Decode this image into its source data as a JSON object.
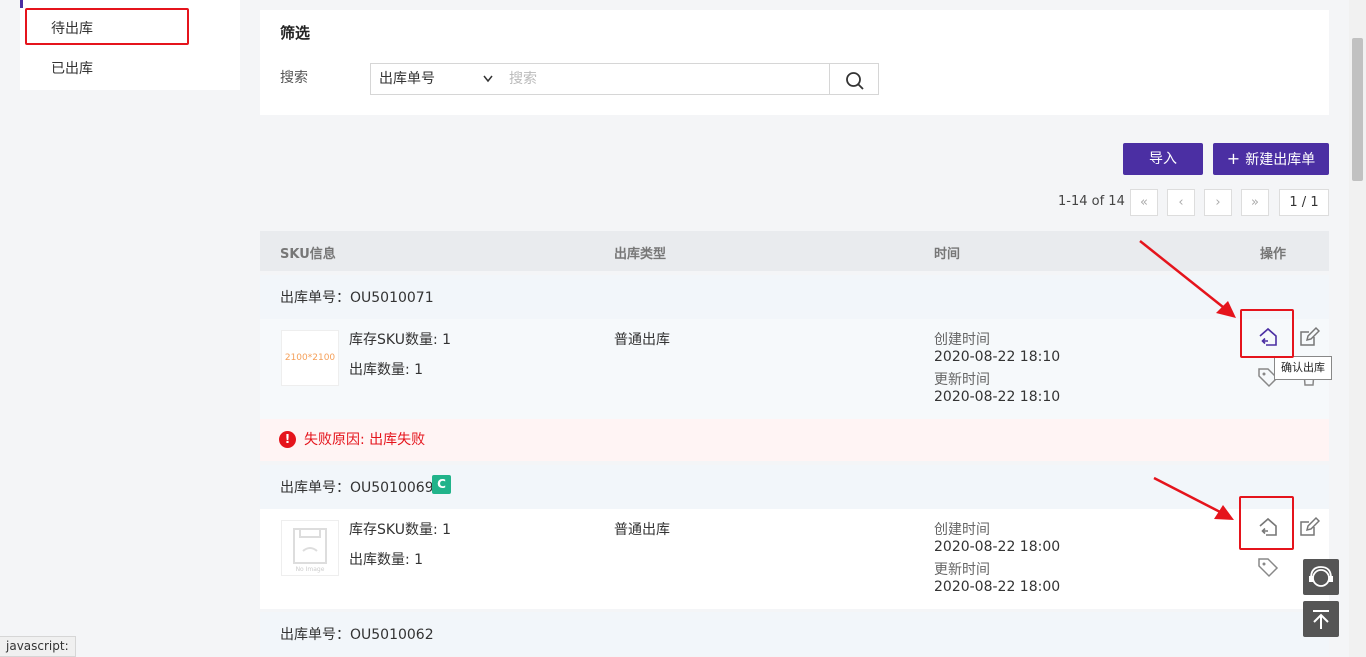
{
  "sidebar": {
    "items": [
      {
        "label": "待出库",
        "active": true
      },
      {
        "label": "已出库",
        "active": false
      }
    ]
  },
  "filter": {
    "title": "筛选",
    "search_label": "搜索",
    "select_value": "出库单号",
    "search_placeholder": "搜索"
  },
  "toolbar": {
    "import_label": "导入",
    "new_label": "新建出库单"
  },
  "pager": {
    "range_text": "1-14 of 14",
    "first": "«",
    "prev": "‹",
    "next": "›",
    "last": "»",
    "page_text": "1 / 1"
  },
  "table": {
    "headers": {
      "sku": "SKU信息",
      "type": "出库类型",
      "time": "时间",
      "ops": "操作"
    }
  },
  "orders": [
    {
      "order_label": "出库单号：OU5010071",
      "badge": "",
      "thumb_text": "2100*2100",
      "sku_count": "库存SKU数量: 1",
      "out_count": "出库数量: 1",
      "type": "普通出库",
      "created_label": "创建时间",
      "created": "2020-08-22 18:10",
      "updated_label": "更新时间",
      "updated": "2020-08-22 18:10",
      "error": "失败原因: 出库失败"
    },
    {
      "order_label": "出库单号：OU5010069",
      "badge": "C",
      "thumb_text": "",
      "sku_count": "库存SKU数量: 1",
      "out_count": "出库数量: 1",
      "type": "普通出库",
      "created_label": "创建时间",
      "created": "2020-08-22 18:00",
      "updated_label": "更新时间",
      "updated": "2020-08-22 18:00",
      "error": ""
    },
    {
      "order_label": "出库单号：OU5010062"
    }
  ],
  "tooltip": "确认出库",
  "status_bar": "javascript:",
  "colors": {
    "primary": "#4b2fa3",
    "annotation_red": "#e5141c",
    "badge_green": "#21b38a",
    "error_bg": "#fff4f4"
  },
  "icons": {
    "confirm": "confirm-outbound-icon",
    "edit": "edit-icon",
    "tag": "tag-icon",
    "delete": "delete-icon",
    "search": "search-icon",
    "support": "customer-service-icon",
    "top": "back-to-top-icon"
  }
}
